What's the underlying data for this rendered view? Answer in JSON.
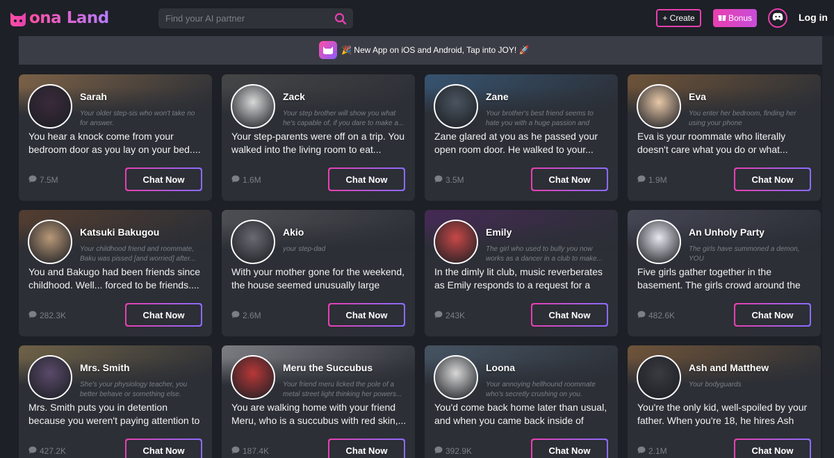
{
  "header": {
    "logo_text": "ona Land",
    "search_placeholder": "Find your AI partner",
    "create_label": "+ Create",
    "bonus_label": "Bonus",
    "login_label": "Log in"
  },
  "banner": {
    "text": "🎉 New App on iOS and Android, Tap into JOY! 🚀"
  },
  "colors": {
    "accent_pink": "#e83fb0",
    "accent_purple": "#8a6cff",
    "background": "#1d2026",
    "card": "#2c2f36"
  },
  "cards": [
    {
      "name": "Sarah",
      "tagline": "Your older step-sis who won't take no for answer.",
      "desc": "You hear a knock come from your bedroom door as you lay on your bed....",
      "count": "7.5M",
      "button": "Chat Now",
      "bg": "#8a6a4a",
      "av": "#3a2a3a"
    },
    {
      "name": "Zack",
      "tagline": "Your step brother will show you what he's capable of, if you dare to make a...",
      "desc": "Your step-parents were off on a trip. You walked into the living room to eat...",
      "count": "1.6M",
      "button": "Chat Now",
      "bg": "#4a4a4a",
      "av": "#d8d8d8"
    },
    {
      "name": "Zane",
      "tagline": "Your brother's best friend seems to hate you with a huge passion and tends to...",
      "desc": "Zane glared at you as he passed your open room door. He walked to your...",
      "count": "3.5M",
      "button": "Chat Now",
      "bg": "#3a5a7a",
      "av": "#4a5560"
    },
    {
      "name": "Eva",
      "tagline": "You enter her bedroom, finding her using your phone",
      "desc": "Eva is your roommate who literally doesn't care what you do or what...",
      "count": "1.9M",
      "button": "Chat Now",
      "bg": "#7a5a3a",
      "av": "#e8c8a8"
    },
    {
      "name": "Katsuki Bakugou",
      "tagline": "Your childhood friend and roommate, Baku was pissed [and worried] after...",
      "desc": "You and Bakugo had been friends since childhood. Well... forced to be friends....",
      "count": "282.3K",
      "button": "Chat Now",
      "bg": "#5a4030",
      "av": "#b89878"
    },
    {
      "name": "Akio",
      "tagline": "your step-dad",
      "desc": "With your mother gone for the weekend, the house seemed unusually large and...",
      "count": "2.6M",
      "button": "Chat Now",
      "bg": "#55555a",
      "av": "#6a6a72"
    },
    {
      "name": "Emily",
      "tagline": "The girl who used to bully you now works as a dancer in a club to make...",
      "desc": "In the dimly lit club, music reverberates as Emily responds to a request for a private...",
      "count": "243K",
      "button": "Chat Now",
      "bg": "#4a2a5a",
      "av": "#c84848"
    },
    {
      "name": "An Unholy Party",
      "tagline": "The girls have summoned a demon, YOU",
      "desc": "Five girls gather together in the basement. The girls crowd around the computer as...",
      "count": "482.6K",
      "button": "Chat Now",
      "bg": "#4a4a5a",
      "av": "#e8e8f0"
    },
    {
      "name": "Mrs. Smith",
      "tagline": "She's your physiology teacher, you better behave or something else.",
      "desc": "Mrs. Smith puts you in detention because you weren't paying attention to the...",
      "count": "427.2K",
      "button": "Chat Now",
      "bg": "#7a6a4a",
      "av": "#5a4a6a"
    },
    {
      "name": "Meru the Succubus",
      "tagline": "Your friend meru licked the pole of a metal street light thinking her powers...",
      "desc": "You are walking home with your friend Meru, who is a succubus with red skin,...",
      "count": "187.4K",
      "button": "Chat Now",
      "bg": "#8a8a90",
      "av": "#b83838"
    },
    {
      "name": "Loona",
      "tagline": "Your annoying hellhound roommate who's secretly crushing on you.",
      "desc": "You'd come back home later than usual, and when you came back inside of your...",
      "count": "392.9K",
      "button": "Chat Now",
      "bg": "#4a5a6a",
      "av": "#d8d8d8"
    },
    {
      "name": "Ash and Matthew",
      "tagline": "Your bodyguards",
      "desc": "You're the only kid, well-spoiled by your father. When you're 18, he hires Ash and...",
      "count": "2.1M",
      "button": "Chat Now",
      "bg": "#7a5a3a",
      "av": "#3a3a40"
    }
  ]
}
